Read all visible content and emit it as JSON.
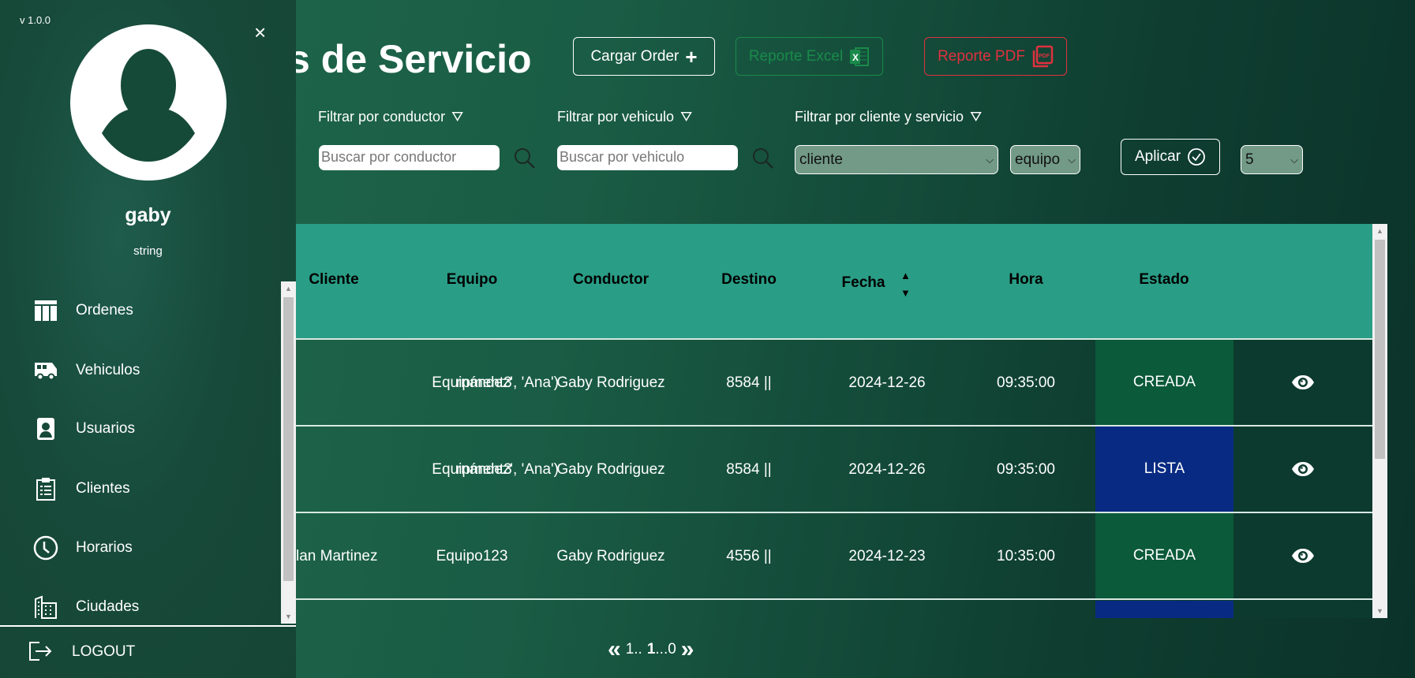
{
  "version": "v 1.0.0",
  "user": {
    "name": "gaby",
    "role": "string"
  },
  "sidebar": {
    "items": [
      {
        "label": "Ordenes",
        "icon": "table-icon"
      },
      {
        "label": "Vehiculos",
        "icon": "van-icon"
      },
      {
        "label": "Usuarios",
        "icon": "user-badge-icon"
      },
      {
        "label": "Clientes",
        "icon": "clipboard-icon"
      },
      {
        "label": "Horarios",
        "icon": "clock-icon"
      },
      {
        "label": "Ciudades",
        "icon": "buildings-icon"
      }
    ],
    "logout": "LOGOUT"
  },
  "page": {
    "title": "Ordenes de Servicio"
  },
  "toolbar": {
    "cargar": "Cargar Order",
    "excel": "Reporte Excel",
    "pdf": "Reporte PDF",
    "excel_color": "#1a8a4a",
    "pdf_color": "#e0313f"
  },
  "filters": {
    "conductor_label": "Filtrar por conductor",
    "conductor_placeholder": "Buscar por conductor",
    "vehiculo_label": "Filtrar por vehiculo",
    "vehiculo_placeholder": "Buscar por vehiculo",
    "cliente_label": "Filtrar por cliente y servicio",
    "cliente_select": "cliente",
    "equipo_select": "equipo",
    "aplicar": "Aplicar",
    "page_size": "5"
  },
  "table": {
    "headers": {
      "cliente": "Cliente",
      "equipo": "Equipo",
      "conductor": "Conductor",
      "destino": "Destino",
      "fecha": "Fecha",
      "hora": "Hora",
      "estado": "Estado"
    },
    "rows": [
      {
        "cliente": "rnández', 'Ana')",
        "equipo": "Equipment3",
        "conductor": "Gaby Rodriguez",
        "destino": "8584 ||",
        "fecha": "2024-12-26",
        "hora": "09:35:00",
        "estado": "CREADA"
      },
      {
        "cliente": "rnández', 'Ana')",
        "equipo": "Equipment3",
        "conductor": "Gaby Rodriguez",
        "destino": "8584 ||",
        "fecha": "2024-12-26",
        "hora": "09:35:00",
        "estado": "LISTA"
      },
      {
        "cliente": "lan Martinez",
        "equipo": "Equipo123",
        "conductor": "Gaby Rodriguez",
        "destino": "4556 ||",
        "fecha": "2024-12-23",
        "hora": "10:35:00",
        "estado": "CREADA"
      }
    ],
    "status_colors": {
      "CREADA": "#0b5a3a",
      "LISTA": "#082a82"
    }
  },
  "pagination": {
    "prev": "«",
    "text_a": "1..",
    "current": "1",
    "text_b": "...0",
    "next": "»"
  }
}
